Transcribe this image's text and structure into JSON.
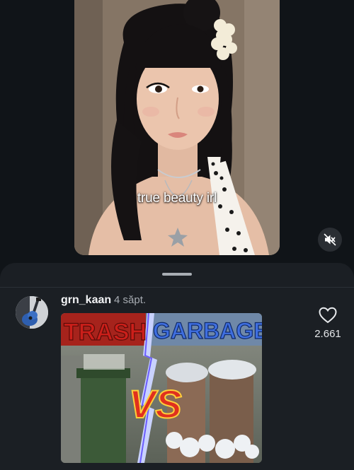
{
  "video": {
    "caption": "true beauty irl",
    "mute_icon": "speaker-muted-icon"
  },
  "comments": {
    "items": [
      {
        "username": "grn_kaan",
        "time": "4 săpt.",
        "avatar_icon": "guitar-avatar",
        "like_icon": "heart-outline-icon",
        "likes": "2.661",
        "gif": {
          "left_word": "TRASH",
          "right_word": "GARBAGE",
          "vs_text": "VS"
        }
      }
    ]
  },
  "colors": {
    "background": "#101418",
    "sheet": "#1b1f24",
    "text": "#f2f3f5",
    "muted_text": "#a7acb2"
  }
}
